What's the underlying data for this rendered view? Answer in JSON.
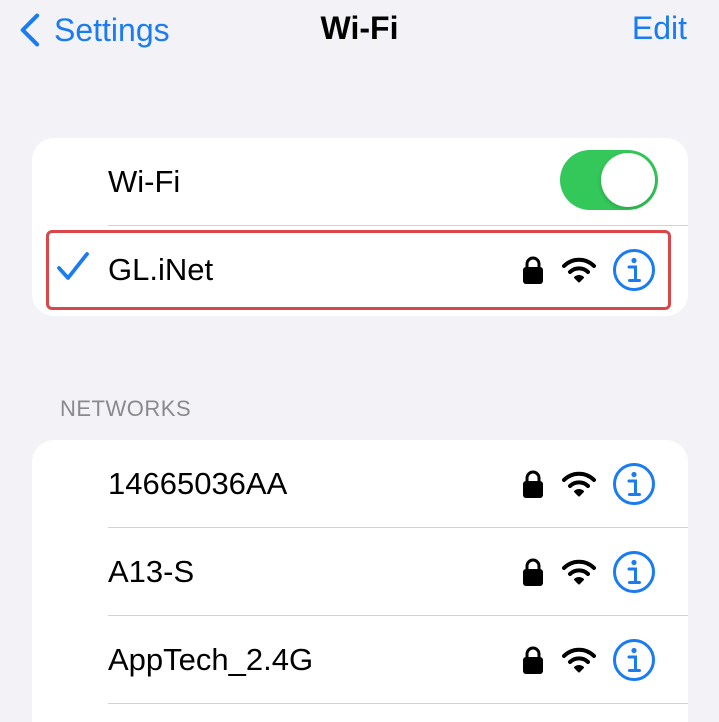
{
  "nav": {
    "back_label": "Settings",
    "title": "Wi-Fi",
    "edit_label": "Edit"
  },
  "wifi_toggle": {
    "label": "Wi-Fi",
    "enabled": true
  },
  "connected_network": {
    "name": "GL.iNet",
    "secured": true,
    "icon_check": "checkmark-icon"
  },
  "networks_section": {
    "header": "NETWORKS",
    "items": [
      {
        "name": "14665036AA",
        "secured": true
      },
      {
        "name": "A13-S",
        "secured": true
      },
      {
        "name": "AppTech_2.4G",
        "secured": true
      }
    ]
  },
  "colors": {
    "accent": "#1a7cf0",
    "toggle_on": "#34c759",
    "highlight": "#d9474a",
    "background": "#f2f2f7"
  },
  "icons": [
    "chevron-left-icon",
    "checkmark-icon",
    "lock-icon",
    "wifi-signal-icon",
    "info-icon"
  ]
}
